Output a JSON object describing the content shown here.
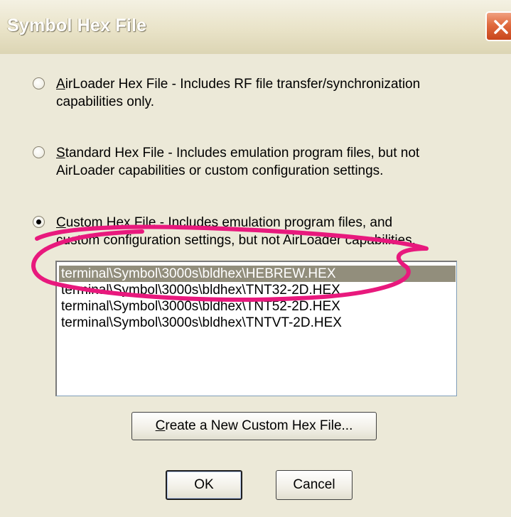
{
  "window": {
    "title": "Symbol Hex File",
    "close_icon": "close-icon"
  },
  "options": [
    {
      "id": "airloader",
      "mnemonic": "A",
      "label_rest": "irLoader Hex File",
      "desc_line1": " -  Includes RF file transfer/synchronization",
      "line2": "capabilities only.",
      "selected": false
    },
    {
      "id": "standard",
      "mnemonic": "S",
      "label_rest": "tandard Hex File",
      "desc_line1": " -  Includes emulation program files, but not",
      "line2": "AirLoader capabilities or custom configuration settings.",
      "selected": false
    },
    {
      "id": "custom",
      "mnemonic": "C",
      "label_rest": "ustom Hex File",
      "desc_line1": " -  Includes emulation program files, and",
      "line2": "custom configuration settings, but not AirLoader capabilities.",
      "selected": true
    }
  ],
  "hex_files": {
    "items": [
      "terminal\\Symbol\\3000s\\bldhex\\HEBREW.HEX",
      "terminal\\Symbol\\3000s\\bldhex\\TNT32-2D.HEX",
      "terminal\\Symbol\\3000s\\bldhex\\TNT52-2D.HEX",
      "terminal\\Symbol\\3000s\\bldhex\\TNTVT-2D.HEX"
    ],
    "selected_index": 0
  },
  "buttons": {
    "create_mnemonic": "C",
    "create_rest": "reate a New Custom Hex File...",
    "ok": "OK",
    "cancel": "Cancel"
  },
  "colors": {
    "dialog_bg": "#ece9d8",
    "selection_bg": "#928e7c",
    "annotation": "#e8197d"
  }
}
